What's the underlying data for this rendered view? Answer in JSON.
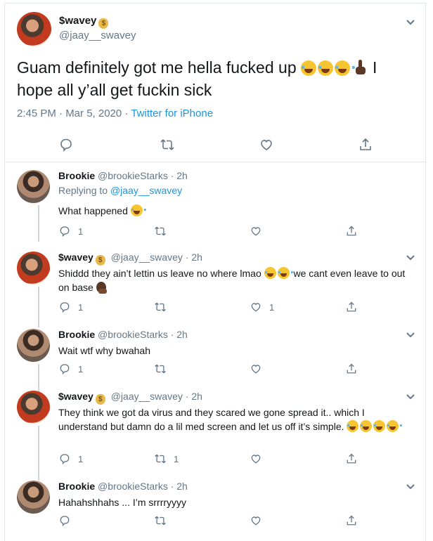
{
  "main_tweet": {
    "display_name": "$wavey",
    "money_emoji": "💰",
    "handle": "@jaay__swavey",
    "text_line1": "Guam definitely got me hella fucked up",
    "text_line2": "I hope all y’all get fuckin sick",
    "timestamp": "2:45 PM · Mar 5, 2020 · ",
    "source": "Twitter for iPhone",
    "icons": [
      "reply-icon",
      "retweet-icon",
      "like-icon",
      "share-icon"
    ]
  },
  "replies": [
    {
      "display_name": "Brookie",
      "handle": "@brookieStarks",
      "time": "· 2h",
      "replying_label": "Replying to ",
      "replying_to": "@jaay__swavey",
      "text": "What happened",
      "reply_count": "1",
      "retweet_count": "",
      "like_count": ""
    },
    {
      "display_name": "$wavey",
      "handle": "@jaay__swavey",
      "time": "· 2h",
      "text_a": "Shiddd they ain’t lettin us leave no where lmao",
      "text_b": "we cant even leave to out on base",
      "reply_count": "1",
      "retweet_count": "",
      "like_count": "1"
    },
    {
      "display_name": "Brookie",
      "handle": "@brookieStarks",
      "time": "· 2h",
      "text": "Wait wtf why bwahah",
      "reply_count": "1",
      "retweet_count": "",
      "like_count": ""
    },
    {
      "display_name": "$wavey",
      "handle": "@jaay__swavey",
      "time": "· 2h",
      "text": "They think we got da virus and they scared we gone spread it.. which I understand but damn do a lil med screen and let us off it’s simple.",
      "reply_count": "1",
      "retweet_count": "1",
      "like_count": ""
    },
    {
      "display_name": "Brookie",
      "handle": "@brookieStarks",
      "time": "· 2h",
      "text": "Hahahshhahs  ... I’m srrrryyyy",
      "reply_count": "",
      "retweet_count": "",
      "like_count": ""
    }
  ]
}
